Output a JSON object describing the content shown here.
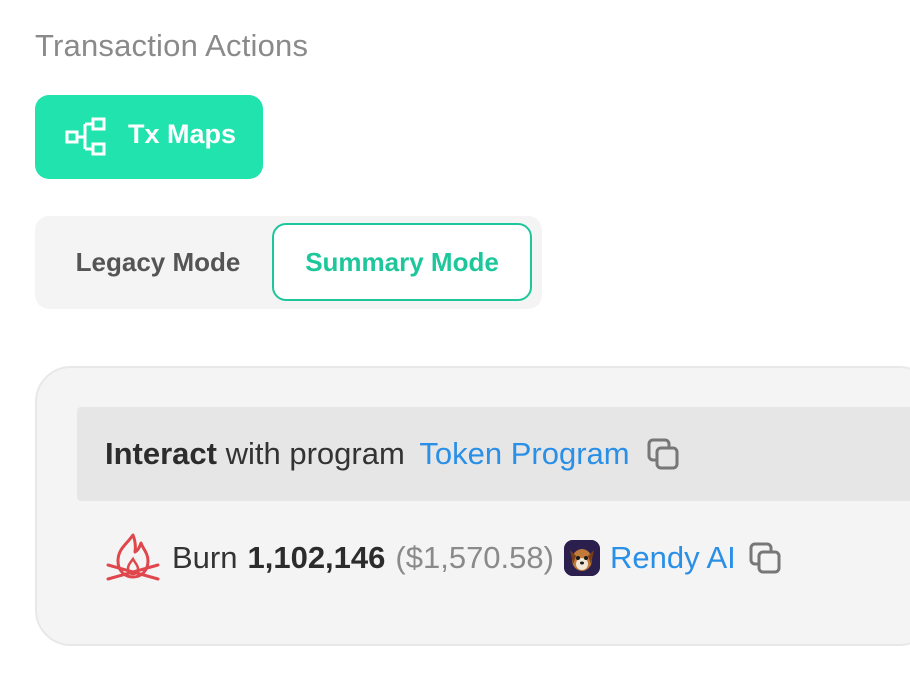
{
  "section": {
    "title": "Transaction Actions"
  },
  "actions": {
    "tx_maps_label": "Tx Maps"
  },
  "mode_toggle": {
    "legacy_label": "Legacy Mode",
    "summary_label": "Summary Mode",
    "selected": "Summary Mode"
  },
  "summary": {
    "program_row": {
      "verb": "Interact",
      "text": "with program",
      "program_name": "Token Program"
    },
    "burn_row": {
      "action": "Burn",
      "amount": "1,102,146",
      "usd_value": "($1,570.58)",
      "token_name": "Rendy AI"
    }
  },
  "colors": {
    "accent": "#20e3ae",
    "accent_text": "#1ec79b",
    "link": "#2a8fe6",
    "burn_icon": "#e0474c"
  },
  "icons": {
    "tx_maps": "tree-map-icon",
    "copy": "copy-icon",
    "burn": "fire-icon",
    "token": "rendy-ai-token-avatar"
  }
}
